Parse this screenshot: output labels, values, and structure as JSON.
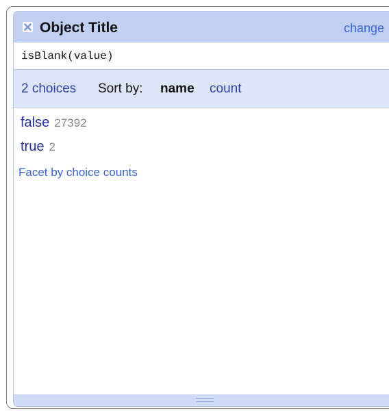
{
  "facet": {
    "title": "Object Title",
    "change_label": "change",
    "expression": "isBlank(value)",
    "choices_count_label": "2 choices",
    "sort_by_label": "Sort by:",
    "sort_name_label": "name",
    "sort_count_label": "count",
    "choices": [
      {
        "label": "false",
        "count": "27392"
      },
      {
        "label": "true",
        "count": "2"
      }
    ],
    "facet_by_counts_label": "Facet by choice counts"
  },
  "icons": {
    "close": "close-icon",
    "resize": "resize-handle-icon"
  },
  "colors": {
    "header_bg": "#bfd0f3",
    "controls_bg": "#dde6f8",
    "link": "#3a63d9",
    "choice": "#2830a8",
    "count": "#888888"
  }
}
